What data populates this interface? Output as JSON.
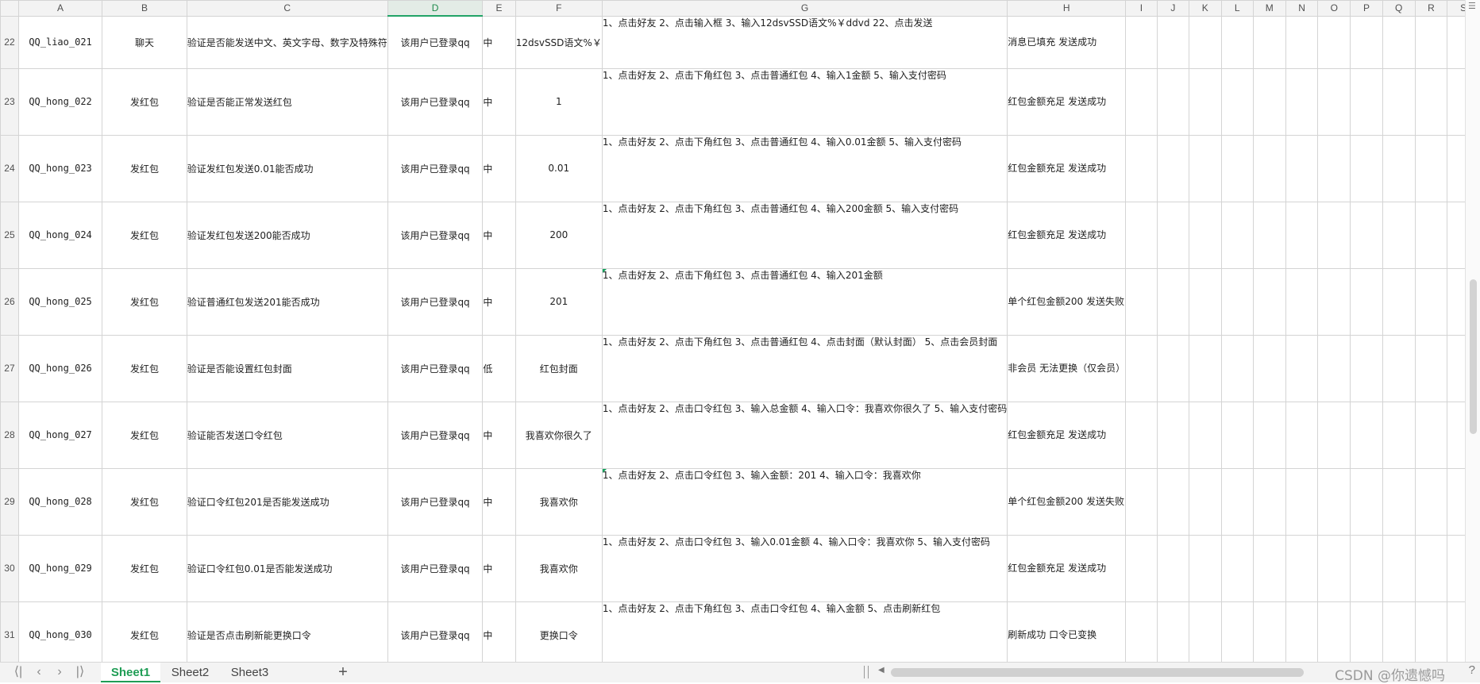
{
  "columns": [
    "A",
    "B",
    "C",
    "D",
    "E",
    "F",
    "G",
    "H",
    "I",
    "J",
    "K",
    "L",
    "M",
    "N",
    "O",
    "P",
    "Q",
    "R",
    "S"
  ],
  "selected_column": "D",
  "rows": [
    {
      "num": "22",
      "a": "QQ_liao_021",
      "b": "聊天",
      "c": "验证是否能发送中文、英文字母、数字及特殊符",
      "d": "该用户已登录qq",
      "e": "中",
      "f": "12dsvSSD语文%￥",
      "g": "1、点击好友\n2、点击输入框\n3、输入12dsvSSD语文%￥ddvd\n22、点击发送",
      "h": "消息已填充\n发送成功"
    },
    {
      "num": "23",
      "a": "QQ_hong_022",
      "b": "发红包",
      "c": "验证是否能正常发送红包",
      "d": "该用户已登录qq",
      "e": "中",
      "f": "1",
      "g": "1、点击好友\n2、点击下角红包\n3、点击普通红包\n4、输入1金额\n5、输入支付密码",
      "h": "红包金额充足\n发送成功"
    },
    {
      "num": "24",
      "a": "QQ_hong_023",
      "b": "发红包",
      "c": "验证发红包发送0.01能否成功",
      "d": "该用户已登录qq",
      "e": "中",
      "f": "0.01",
      "g": "1、点击好友\n2、点击下角红包\n3、点击普通红包\n4、输入0.01金额\n5、输入支付密码",
      "h": "红包金额充足\n发送成功"
    },
    {
      "num": "25",
      "a": "QQ_hong_024",
      "b": "发红包",
      "c": "验证发红包发送200能否成功",
      "d": "该用户已登录qq",
      "e": "中",
      "f": "200",
      "g": "1、点击好友\n2、点击下角红包\n3、点击普通红包\n4、输入200金额\n5、输入支付密码",
      "h": "红包金额充足\n发送成功"
    },
    {
      "num": "26",
      "a": "QQ_hong_025",
      "b": "发红包",
      "c": "验证普通红包发送201能否成功",
      "d": "该用户已登录qq",
      "e": "中",
      "f": "201",
      "g": "1、点击好友\n2、点击下角红包\n3、点击普通红包\n4、输入201金额",
      "h": "单个红包金额200\n发送失败"
    },
    {
      "num": "27",
      "a": "QQ_hong_026",
      "b": "发红包",
      "c": "验证是否能设置红包封面",
      "d": "该用户已登录qq",
      "e": "低",
      "f": "红包封面",
      "g": "1、点击好友\n2、点击下角红包\n3、点击普通红包\n4、点击封面（默认封面）\n5、点击会员封面",
      "h": "非会员\n无法更换（仅会员）"
    },
    {
      "num": "28",
      "a": "QQ_hong_027",
      "b": "发红包",
      "c": "验证能否发送口令红包",
      "d": "该用户已登录qq",
      "e": "中",
      "f": "我喜欢你很久了",
      "g": "1、点击好友\n2、点击口令红包\n3、输入总金额\n4、输入口令：我喜欢你很久了\n5、输入支付密码",
      "h": "红包金额充足\n发送成功"
    },
    {
      "num": "29",
      "a": "QQ_hong_028",
      "b": "发红包",
      "c": "验证口令红包201是否能发送成功",
      "d": "该用户已登录qq",
      "e": "中",
      "f": "我喜欢你",
      "g": "1、点击好友\n2、点击口令红包\n3、输入金额：201\n4、输入口令：我喜欢你",
      "h": "单个红包金额200\n发送失败"
    },
    {
      "num": "30",
      "a": "QQ_hong_029",
      "b": "发红包",
      "c": "验证口令红包0.01是否能发送成功",
      "d": "该用户已登录qq",
      "e": "中",
      "f": "我喜欢你",
      "g": "1、点击好友\n2、点击口令红包\n3、输入0.01金额\n4、输入口令：我喜欢你\n5、输入支付密码",
      "h": "红包金额充足\n发送成功"
    },
    {
      "num": "31",
      "a": "QQ_hong_030",
      "b": "发红包",
      "c": "验证是否点击刷新能更换口令",
      "d": "该用户已登录qq",
      "e": "中",
      "f": "更换口令",
      "g": "1、点击好友\n2、点击下角红包\n3、点击口令红包\n4、输入金额\n5、点击刷新红包",
      "h": "刷新成功\n口令已变换"
    }
  ],
  "sheets": [
    {
      "label": "Sheet1",
      "active": true
    },
    {
      "label": "Sheet2",
      "active": false
    },
    {
      "label": "Sheet3",
      "active": false
    }
  ],
  "icons": {
    "first": "⟨|",
    "prev": "‹",
    "next": "›",
    "last": "|⟩",
    "add": "+"
  },
  "watermark": "CSDN @你遗憾吗",
  "help": "?"
}
